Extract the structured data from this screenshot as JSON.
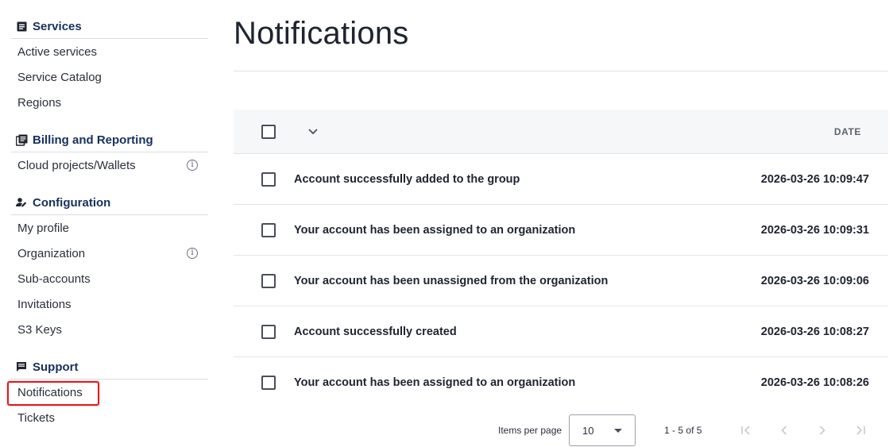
{
  "sidebar": {
    "sections": [
      {
        "title": "Services",
        "icon": "document-icon",
        "items": [
          {
            "label": "Active services"
          },
          {
            "label": "Service Catalog"
          },
          {
            "label": "Regions"
          }
        ]
      },
      {
        "title": "Billing and Reporting",
        "icon": "library-books-icon",
        "items": [
          {
            "label": "Cloud projects/Wallets",
            "info": true
          }
        ]
      },
      {
        "title": "Configuration",
        "icon": "person-edit-icon",
        "items": [
          {
            "label": "My profile"
          },
          {
            "label": "Organization",
            "info": true
          },
          {
            "label": "Sub-accounts"
          },
          {
            "label": "Invitations"
          },
          {
            "label": "S3 Keys"
          }
        ]
      },
      {
        "title": "Support",
        "icon": "message-icon",
        "items": [
          {
            "label": "Notifications",
            "active": true
          },
          {
            "label": "Tickets"
          }
        ]
      }
    ],
    "info_glyph": "i"
  },
  "main": {
    "title": "Notifications",
    "table": {
      "date_header": "DATE",
      "rows": [
        {
          "message": "Account successfully added to the group",
          "date": "2026-03-26 10:09:47"
        },
        {
          "message": "Your account has been assigned to an organization",
          "date": "2026-03-26 10:09:31"
        },
        {
          "message": "Your account has been unassigned from the organization",
          "date": "2026-03-26 10:09:06"
        },
        {
          "message": "Account successfully created",
          "date": "2026-03-26 10:08:27"
        },
        {
          "message": "Your account has been assigned to an organization",
          "date": "2026-03-26 10:08:26"
        }
      ]
    },
    "paginator": {
      "items_per_page_label": "Items per page",
      "items_per_page_value": "10",
      "range_label": "1 - 5 of 5"
    }
  },
  "colors": {
    "section_title": "#16305e",
    "highlight_border": "#e0191e",
    "header_bg": "#f6f7f9"
  }
}
